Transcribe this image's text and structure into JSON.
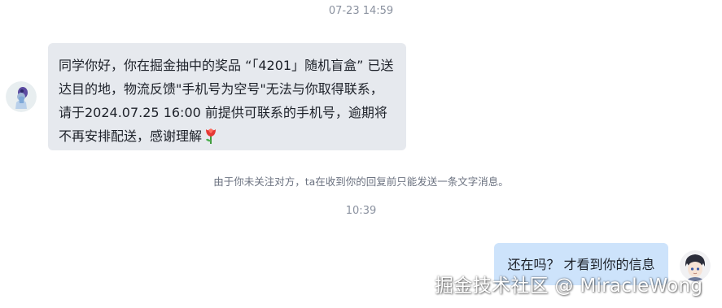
{
  "conversation": {
    "timestamp_1": "07-23 14:59",
    "incoming_message": {
      "text": "同学你好，你在掘金抽中的奖品 “「4201」随机盲盒” 已送达目的地，物流反馈\"手机号为空号\"无法与你取得联系，请于2024.07.25 16:00 前提供可联系的手机号，逾期将不再安排配送，感谢理解",
      "emoji": "tulip-emoji"
    },
    "notice": "由于你未关注对方，ta在收到你的回复前只能发送一条文字消息。",
    "timestamp_2": "10:39",
    "outgoing_message": {
      "text": "还在吗？ 才看到你的信息"
    }
  },
  "watermark": "掘金技术社区 @ MiracleWong",
  "colors": {
    "incoming_bubble": "#e6e9ee",
    "outgoing_bubble": "#cde3fb",
    "timestamp_text": "#8a919f"
  }
}
